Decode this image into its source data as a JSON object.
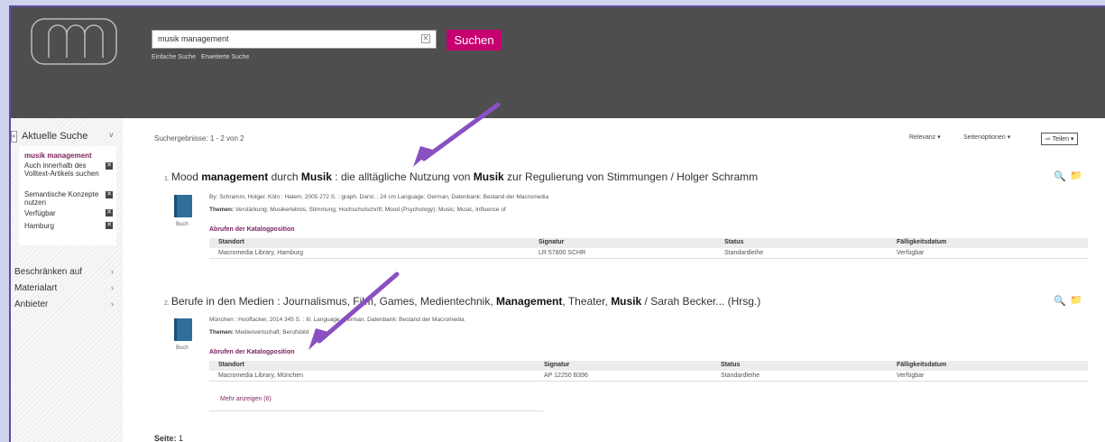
{
  "search": {
    "query": "musik management",
    "button_label": "Suchen",
    "link_simple": "Einfache Suche",
    "link_advanced": "Erweiterte Suche",
    "clear_glyph": "✕"
  },
  "sidebar": {
    "collapse_glyph": "«",
    "current_search_title": "Aktuelle Suche",
    "chevron_down": "˅",
    "active_term": "musik management",
    "filters": [
      {
        "label": "Auch innerhalb des Volltext-Artikels suchen"
      },
      {
        "label": "Semantische Konzepte nutzen"
      },
      {
        "label": "Verfügbar"
      },
      {
        "label": "Hamburg"
      }
    ],
    "remove_glyph": "✕",
    "sections": [
      {
        "label": "Beschränken auf"
      },
      {
        "label": "Materialart"
      },
      {
        "label": "Anbieter"
      }
    ],
    "chevron_right": "›"
  },
  "results": {
    "count_text": "Suchergebnisse: 1 - 2 von 2",
    "sort_label": "Relevanz ▾",
    "page_options_label": "Seitenoptionen ▾",
    "share_label": "⇨ Teilen ▾",
    "items": [
      {
        "number": "1.",
        "title_parts": [
          "Mood ",
          "management",
          " durch ",
          "Musik",
          " : die alltägliche Nutzung von ",
          "Musik",
          " zur Regulierung von Stimmungen / Holger Schramm"
        ],
        "type_label": "Buch",
        "byline": "By: Schramm, Holger. Köln : Halem, 2005 272 S. : graph. Darst. ; 24 cm Language: German, Datenbank: Bestand der Macromedia",
        "themes_label": "Themen:",
        "themes": " Verstärkung; Musikerlebnis; Stimmung; Hochschulschrift; Mood (Psychology); Music; Music, Influence of",
        "retrieve_label": "Abrufen der Katalogposition",
        "headers": [
          "Standort",
          "Signatur",
          "Status",
          "Fälligkeitsdatum"
        ],
        "rows": [
          [
            "Macromedia Library, Hamburg",
            "LR 57800 SCHR",
            "Standardleihe",
            "Verfügbar"
          ]
        ]
      },
      {
        "number": "2.",
        "title_parts": [
          "Berufe in den Medien : Journalismus, Film, Games, Medientechnik, ",
          "Management",
          ", Theater, ",
          "Musik",
          " / Sarah Becker... (Hrsg.)"
        ],
        "type_label": "Buch",
        "byline": "München : Hooffacker, 2014 345 S. : Ill. Language: German, Datenbank: Bestand der Macromedia",
        "themes_label": "Themen:",
        "themes": " Medienwirtschaft; Berufsbild",
        "retrieve_label": "Abrufen der Katalogposition",
        "headers": [
          "Standort",
          "Signatur",
          "Status",
          "Fälligkeitsdatum"
        ],
        "rows": [
          [
            "Macromedia Library, München",
            "AP 12250 B396",
            "Standardleihe",
            "Verfügbar"
          ]
        ],
        "more_label": "Mehr anzeigen (6)"
      }
    ],
    "page_label": "Seite:",
    "page_number": "1",
    "icon_zoom": "🔍",
    "icon_folder": "📁"
  }
}
